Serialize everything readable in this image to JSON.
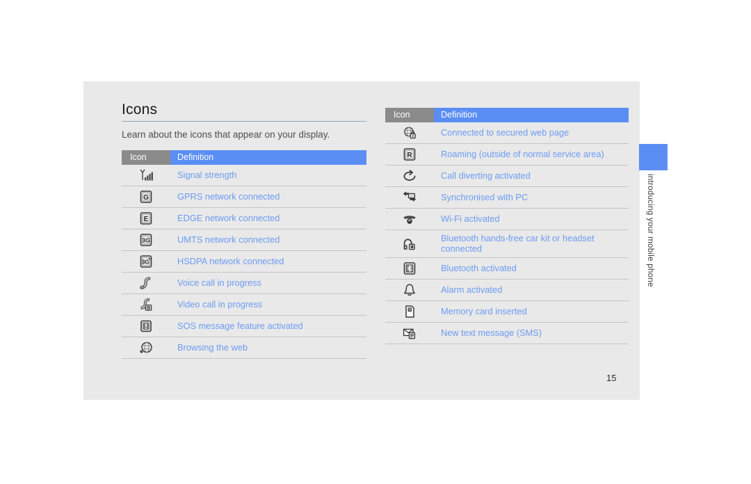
{
  "document": {
    "page_title": "Icons",
    "intro": "Learn about the icons that appear on your display.",
    "page_number": "15",
    "side_tab_label": "introducing your mobile phone"
  },
  "colors": {
    "accent_blue": "#5b8ef5",
    "text_blue": "#6c9bf2",
    "header_gray": "#8b8b8b",
    "sheet_gray": "#e9e9e9",
    "rule_gray": "#c4c4c4",
    "title_rule": "#8fa3c8"
  },
  "table_headers": {
    "icon": "Icon",
    "definition": "Definition"
  },
  "left_table": {
    "header": {
      "icon": "Icon",
      "definition": "Definition"
    },
    "rows": [
      {
        "icon": "signal-strength-icon",
        "definition": "Signal strength"
      },
      {
        "icon": "gprs-network-icon",
        "definition": "GPRS network connected"
      },
      {
        "icon": "edge-network-icon",
        "definition": "EDGE network connected"
      },
      {
        "icon": "umts-network-icon",
        "definition": "UMTS network connected"
      },
      {
        "icon": "hsdpa-network-icon",
        "definition": "HSDPA network connected"
      },
      {
        "icon": "voice-call-icon",
        "definition": "Voice call in progress"
      },
      {
        "icon": "video-call-icon",
        "definition": "Video call in progress"
      },
      {
        "icon": "sos-message-icon",
        "definition": "SOS message feature activated"
      },
      {
        "icon": "browsing-web-icon",
        "definition": "Browsing the web"
      }
    ]
  },
  "right_table": {
    "header": {
      "icon": "Icon",
      "definition": "Definition"
    },
    "rows": [
      {
        "icon": "secure-web-icon",
        "definition": "Connected to secured web page"
      },
      {
        "icon": "roaming-icon",
        "definition": "Roaming (outside of normal service area)"
      },
      {
        "icon": "call-diverting-icon",
        "definition": "Call diverting activated"
      },
      {
        "icon": "sync-pc-icon",
        "definition": "Synchronised with PC"
      },
      {
        "icon": "wifi-icon",
        "definition": "Wi-Fi activated"
      },
      {
        "icon": "bluetooth-headset-icon",
        "definition": "Bluetooth hands-free car kit or headset connected"
      },
      {
        "icon": "bluetooth-icon",
        "definition": "Bluetooth activated"
      },
      {
        "icon": "alarm-icon",
        "definition": "Alarm activated"
      },
      {
        "icon": "memory-card-icon",
        "definition": "Memory card inserted"
      },
      {
        "icon": "new-sms-icon",
        "definition": "New text message (SMS)"
      }
    ]
  }
}
